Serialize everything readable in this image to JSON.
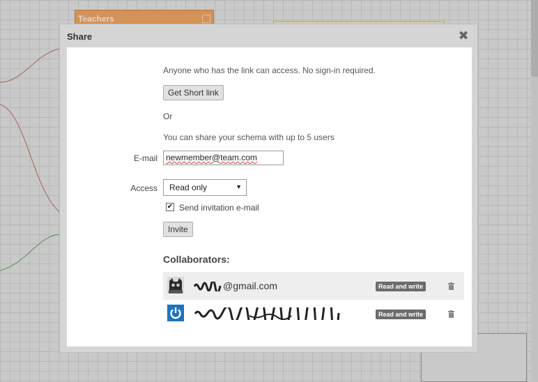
{
  "background": {
    "table_card_title": "Teachers"
  },
  "dialog": {
    "title": "Share",
    "close_symbol": "✖",
    "link_info": "Anyone who has the link can access. No sign-in required.",
    "get_short_link_label": "Get Short link",
    "or_label": "Or",
    "share_info": "You can share your schema with up to 5 users",
    "email_label": "E-mail",
    "email_value": "newmember@team.com",
    "access_label": "Access",
    "access_selected": "Read only",
    "send_invitation_label": "Send invitation e-mail",
    "send_invitation_checked": true,
    "invite_label": "Invite",
    "collaborators_heading": "Collaborators:",
    "collaborators": [
      {
        "email_visible": "@gmail.com",
        "permission": "Read and write",
        "avatar_icon": "cat-avatar-icon"
      },
      {
        "email_visible": "",
        "permission": "Read and write",
        "avatar_icon": "power-avatar-icon"
      }
    ]
  },
  "colors": {
    "accent_orange": "#f2a560",
    "badge_gray": "#6b6b6b",
    "avatar_blue": "#1e73be"
  }
}
